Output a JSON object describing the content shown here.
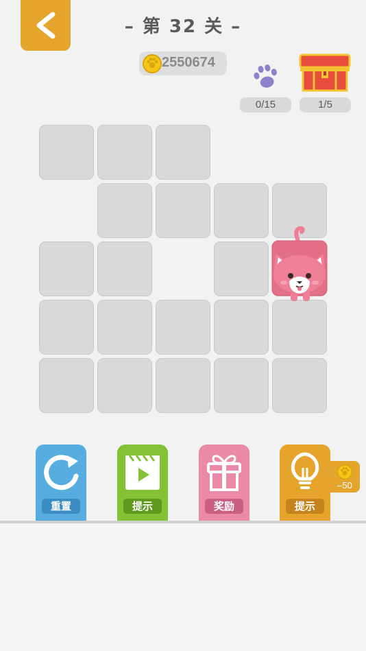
{
  "header": {
    "level_title": "– 第 32 关 –",
    "coins": "2550674"
  },
  "stats": {
    "paws": "0/15",
    "chests": "1/5"
  },
  "board": {
    "rows": [
      [
        1,
        1,
        1,
        0,
        0
      ],
      [
        0,
        1,
        1,
        1,
        1
      ],
      [
        1,
        1,
        0,
        1,
        1
      ],
      [
        1,
        1,
        1,
        1,
        1
      ],
      [
        1,
        1,
        1,
        1,
        1
      ]
    ],
    "cat_position": {
      "row": 2,
      "col": 4
    }
  },
  "toolbar": {
    "reset_label": "重置",
    "video_hint_label": "提示",
    "reward_label": "奖励",
    "hint_label": "提示",
    "hint_cost": "–50"
  },
  "colors": {
    "accent": "#e5a42b",
    "reset": "#58ade0",
    "video": "#83c135",
    "reward": "#ea8aa6",
    "cat": "#ee7f97"
  }
}
